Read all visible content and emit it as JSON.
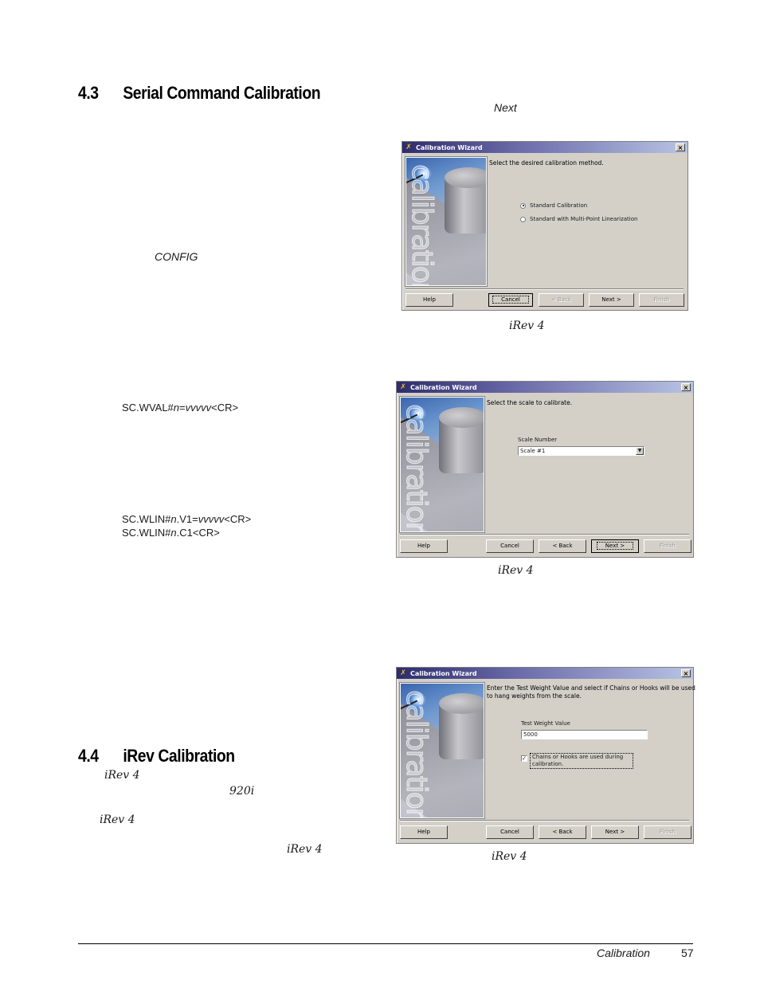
{
  "page": {
    "sections": [
      {
        "number": "4.3",
        "title": "Serial Command Calibration"
      },
      {
        "number": "4.4",
        "title": "iRev Calibration"
      }
    ],
    "fragments": {
      "next_ref": "Next",
      "config_ref": "CONFIG",
      "irev_ref_1": "iRev 4",
      "model_ref": "920i",
      "irev_ref_2": "iRev 4",
      "irev_ref_3": "iRev 4"
    },
    "commands": {
      "wval": {
        "prefix": "SC.WVAL#",
        "n": "n",
        "eq": "=",
        "value": "vvvvv",
        "suffix": "<CR>"
      },
      "wlin_v1": {
        "prefix": "SC.WLIN#",
        "n": "n",
        "mid": ".V1=",
        "value": "vvvvv",
        "suffix": "<CR>"
      },
      "wlin_c1": {
        "prefix": "SC.WLIN#",
        "n": "n",
        "suffix": ".C1<CR>"
      }
    },
    "footer": {
      "section": "Calibration",
      "page_number": "57"
    }
  },
  "wizards": [
    {
      "title": "Calibration Wizard",
      "watermark": "calibration",
      "prompt": "Select the desired calibration method.",
      "radio_options": [
        {
          "label": "Standard Calibration",
          "selected": true
        },
        {
          "label": "Standard with Multi-Point Linearization",
          "selected": false
        }
      ],
      "buttons": {
        "help": "Help",
        "cancel": "Cancel",
        "back": "< Back",
        "next": "Next >",
        "finish": "Finish"
      },
      "caption": "iRev 4"
    },
    {
      "title": "Calibration Wizard",
      "watermark": "calibration",
      "prompt": "Select the scale to calibrate.",
      "scale_label": "Scale Number",
      "scale_value": "Scale #1",
      "buttons": {
        "help": "Help",
        "cancel": "Cancel",
        "back": "< Back",
        "next": "Next >",
        "finish": "Finish"
      },
      "caption": "iRev 4"
    },
    {
      "title": "Calibration Wizard",
      "watermark": "calibration",
      "prompt_line1": "Enter the Test Weight Value and select if Chains or Hooks will be used",
      "prompt_line2": "to hang weights from the scale.",
      "test_weight_label": "Test Weight Value",
      "test_weight_value": "5000",
      "checkbox_label": "Chains or Hooks are used during calibration.",
      "checkbox_checked": true,
      "buttons": {
        "help": "Help",
        "cancel": "Cancel",
        "back": "< Back",
        "next": "Next >",
        "finish": "Finish"
      },
      "caption": "iRev 4"
    }
  ]
}
